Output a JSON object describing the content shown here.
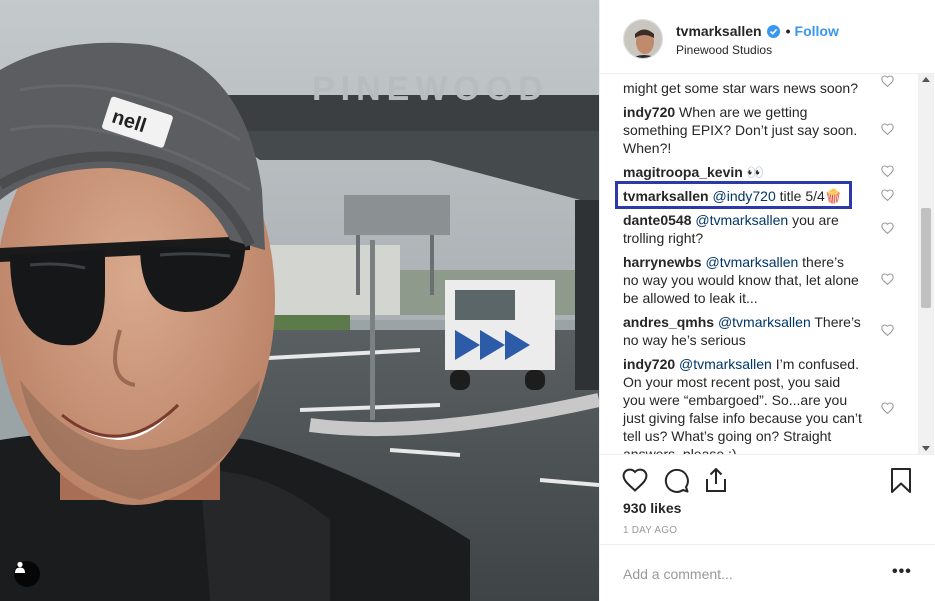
{
  "post": {
    "username": "tvmarksallen",
    "follow_label": "Follow",
    "location": "Pinewood Studios",
    "sign_text": "PINEWOOD",
    "beanie_text": "nell"
  },
  "comments": [
    {
      "user": "",
      "text": "might get some star wars news soon?"
    },
    {
      "user": "indy720",
      "text": "When are we getting something EPIX? Don’t just say soon. When?!"
    },
    {
      "user": "magitroopa_kevin",
      "text": "👀"
    },
    {
      "user": "tvmarksallen",
      "mention": "@indy720",
      "text": "title 5/4🍿"
    },
    {
      "user": "dante0548",
      "mention": "@tvmarksallen",
      "text": "you are trolling right?"
    },
    {
      "user": "harrynewbs",
      "mention": "@tvmarksallen",
      "text": "there’s no way you would know that, let alone be allowed to leak it..."
    },
    {
      "user": "andres_qmhs",
      "mention": "@tvmarksallen",
      "text": "There’s no way he’s serious"
    },
    {
      "user": "indy720",
      "mention": "@tvmarksallen",
      "text": "I’m confused. On your most recent post, you said you were “embargoed”. So...are you just giving false info because you can’t tell us? What’s going on? Straight answers, please :)"
    }
  ],
  "stats": {
    "likes": "930 likes",
    "time": "1 DAY AGO"
  },
  "composer": {
    "placeholder": "Add a comment...",
    "more_label": "•••"
  },
  "icons": {
    "verified": "verified-badge-icon",
    "heart": "heart-outline-icon",
    "comment": "comment-bubble-icon",
    "share": "share-upload-icon",
    "bookmark": "bookmark-icon",
    "user_tag": "user-tag-icon"
  },
  "colors": {
    "link_blue": "#3897f0",
    "mention_blue": "#003569",
    "highlight": "#2b3aa8",
    "text": "#262626",
    "muted": "#999999"
  }
}
